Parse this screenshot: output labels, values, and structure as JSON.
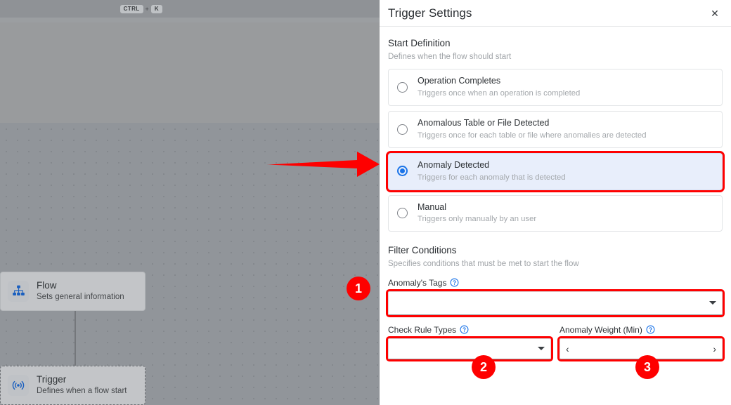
{
  "canvas": {
    "shortcut": {
      "key1": "CTRL",
      "plus": "+",
      "key2": "K"
    },
    "nodes": [
      {
        "title": "Flow",
        "subtitle": "Sets general information",
        "icon": "hierarchy-icon"
      },
      {
        "title": "Trigger",
        "subtitle": "Defines when a flow start",
        "icon": "broadcast-icon"
      }
    ]
  },
  "panel": {
    "title": "Trigger Settings",
    "close_label": "✕",
    "start_definition": {
      "title": "Start Definition",
      "subtitle": "Defines when the flow should start",
      "options": [
        {
          "label": "Operation Completes",
          "description": "Triggers once when an operation is completed",
          "selected": false
        },
        {
          "label": "Anomalous Table or File Detected",
          "description": "Triggers once for each table or file where anomalies are detected",
          "selected": false
        },
        {
          "label": "Anomaly Detected",
          "description": "Triggers for each anomaly that is detected",
          "selected": true
        },
        {
          "label": "Manual",
          "description": "Triggers only manually by an user",
          "selected": false
        }
      ]
    },
    "filter_conditions": {
      "title": "Filter Conditions",
      "subtitle": "Specifies conditions that must be met to start the flow",
      "anomaly_tags": {
        "label": "Anomaly's Tags",
        "value": "",
        "help": "help-icon"
      },
      "check_rule_types": {
        "label": "Check Rule Types",
        "value": "",
        "help": "help-icon"
      },
      "anomaly_weight_min": {
        "label": "Anomaly Weight (Min)",
        "value": "",
        "prev": "‹",
        "next": "›",
        "help": "help-icon"
      }
    }
  },
  "annotations": {
    "badges": [
      "1",
      "2",
      "3"
    ],
    "arrow_color": "#fe0000",
    "highlight_color": "#fe0000"
  },
  "colors": {
    "accent_blue": "#1a73e8",
    "selected_bg": "#e8eefb",
    "annotation_red": "#fe0000",
    "canvas_grey": "#999b9d"
  }
}
